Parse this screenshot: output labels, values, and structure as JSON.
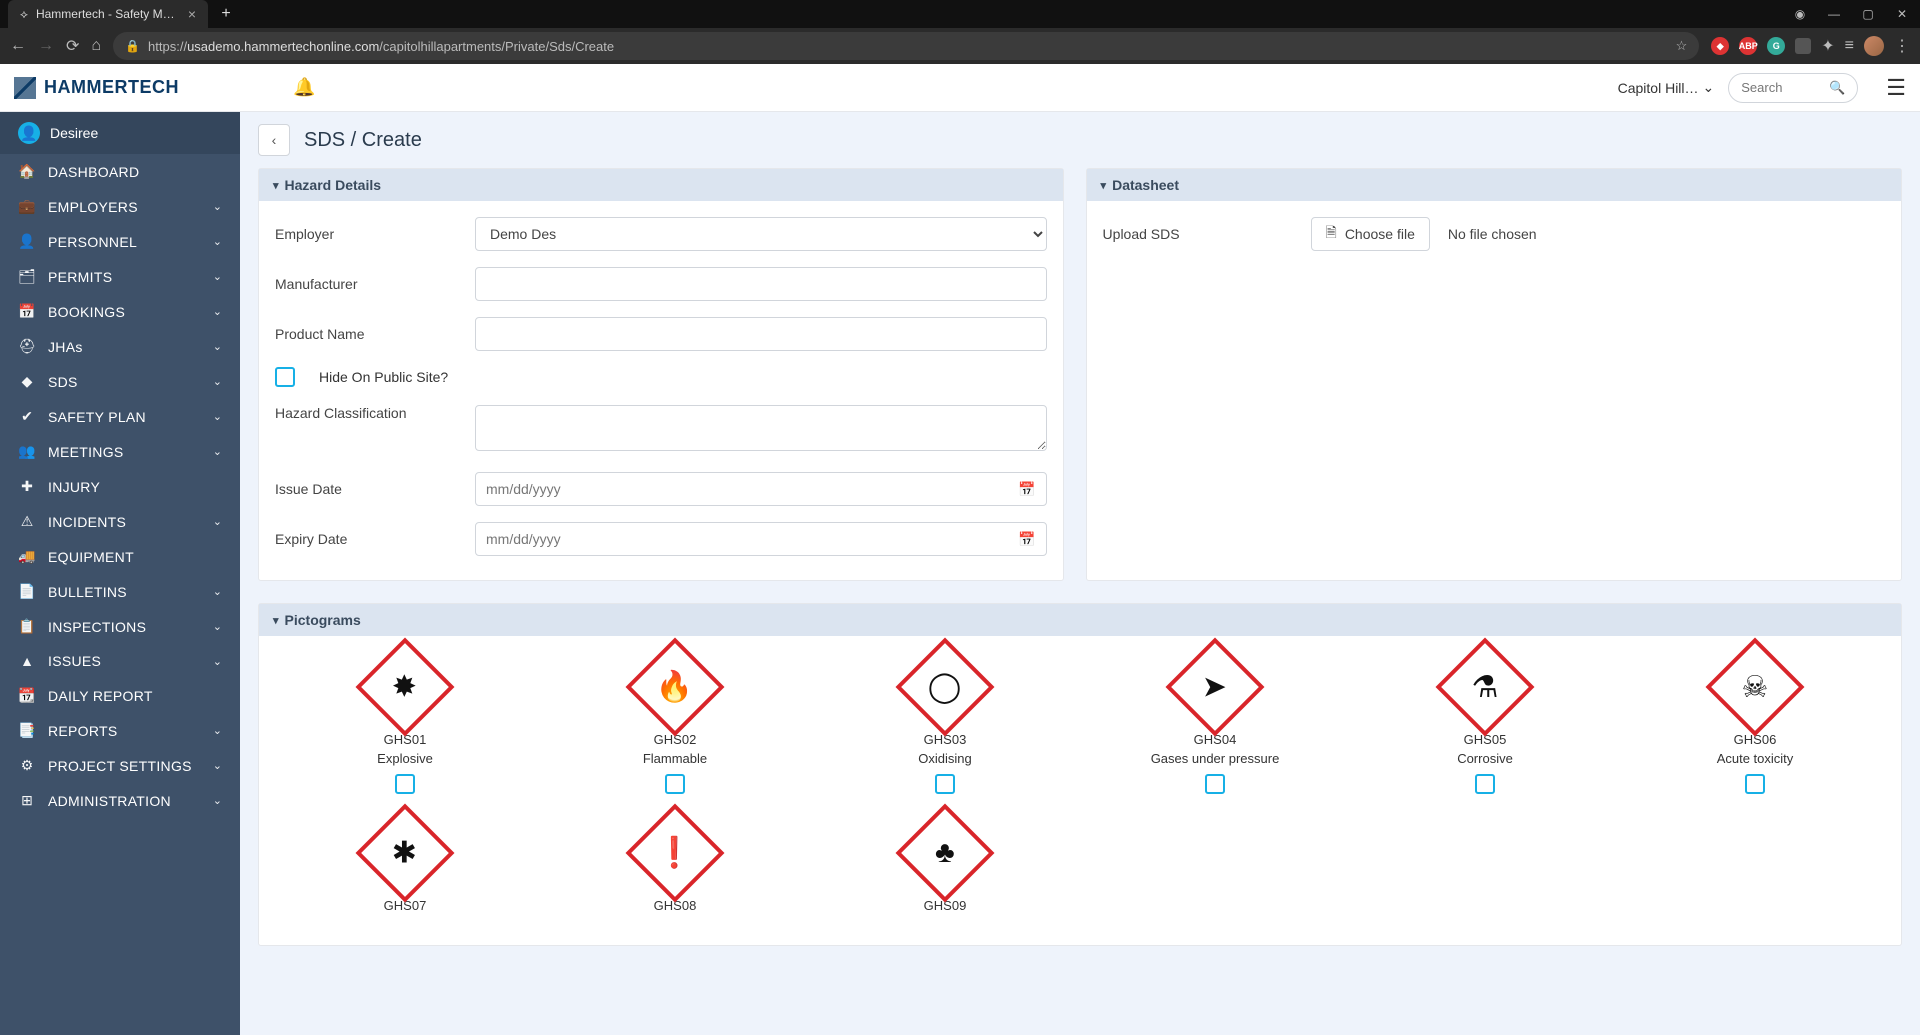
{
  "browser": {
    "tab_title": "Hammertech - Safety Manageme",
    "url_prefix": "https://",
    "url_host": "usademo.hammertechonline.com",
    "url_path": "/capitolhillapartments/Private/Sds/Create"
  },
  "header": {
    "brand": "HAMMERTECH",
    "site_selector": "Capitol Hill…",
    "search_placeholder": "Search"
  },
  "sidebar": {
    "user": "Desiree",
    "items": [
      {
        "icon": "home",
        "label": "DASHBOARD",
        "expandable": false
      },
      {
        "icon": "briefcase",
        "label": "EMPLOYERS",
        "expandable": true
      },
      {
        "icon": "person",
        "label": "PERSONNEL",
        "expandable": true
      },
      {
        "icon": "card",
        "label": "PERMITS",
        "expandable": true
      },
      {
        "icon": "calendar",
        "label": "BOOKINGS",
        "expandable": true
      },
      {
        "icon": "hardhat",
        "label": "JHAs",
        "expandable": true
      },
      {
        "icon": "diamond",
        "label": "SDS",
        "expandable": true
      },
      {
        "icon": "check",
        "label": "SAFETY PLAN",
        "expandable": true
      },
      {
        "icon": "people",
        "label": "MEETINGS",
        "expandable": true
      },
      {
        "icon": "plus",
        "label": "INJURY",
        "expandable": false
      },
      {
        "icon": "warning",
        "label": "INCIDENTS",
        "expandable": true
      },
      {
        "icon": "truck",
        "label": "EQUIPMENT",
        "expandable": false
      },
      {
        "icon": "list",
        "label": "BULLETINS",
        "expandable": true
      },
      {
        "icon": "clipboard",
        "label": "INSPECTIONS",
        "expandable": true
      },
      {
        "icon": "triangle",
        "label": "ISSUES",
        "expandable": true
      },
      {
        "icon": "date",
        "label": "DAILY REPORT",
        "expandable": false
      },
      {
        "icon": "report",
        "label": "REPORTS",
        "expandable": true
      },
      {
        "icon": "gear",
        "label": "PROJECT SETTINGS",
        "expandable": true
      },
      {
        "icon": "admin",
        "label": "ADMINISTRATION",
        "expandable": true
      }
    ]
  },
  "page": {
    "title": "SDS / Create"
  },
  "hazard_panel": {
    "title": "Hazard Details",
    "employer_label": "Employer",
    "employer_value": "Demo Des",
    "manufacturer_label": "Manufacturer",
    "product_label": "Product Name",
    "hide_label": "Hide On Public Site?",
    "class_label": "Hazard Classification",
    "issue_label": "Issue Date",
    "expiry_label": "Expiry Date",
    "date_placeholder": "mm/dd/yyyy"
  },
  "datasheet_panel": {
    "title": "Datasheet",
    "upload_label": "Upload SDS",
    "choose_label": "Choose file",
    "no_file": "No file chosen"
  },
  "pictograms_panel": {
    "title": "Pictograms",
    "items": [
      {
        "code": "GHS01",
        "name": "Explosive",
        "glyph": "✸"
      },
      {
        "code": "GHS02",
        "name": "Flammable",
        "glyph": "🔥"
      },
      {
        "code": "GHS03",
        "name": "Oxidising",
        "glyph": "◯"
      },
      {
        "code": "GHS04",
        "name": "Gases under pressure",
        "glyph": "➤"
      },
      {
        "code": "GHS05",
        "name": "Corrosive",
        "glyph": "⚗"
      },
      {
        "code": "GHS06",
        "name": "Acute toxicity",
        "glyph": "☠"
      },
      {
        "code": "GHS07",
        "name": "",
        "glyph": "✱"
      },
      {
        "code": "GHS08",
        "name": "",
        "glyph": "❗"
      },
      {
        "code": "GHS09",
        "name": "",
        "glyph": "♣"
      }
    ]
  }
}
